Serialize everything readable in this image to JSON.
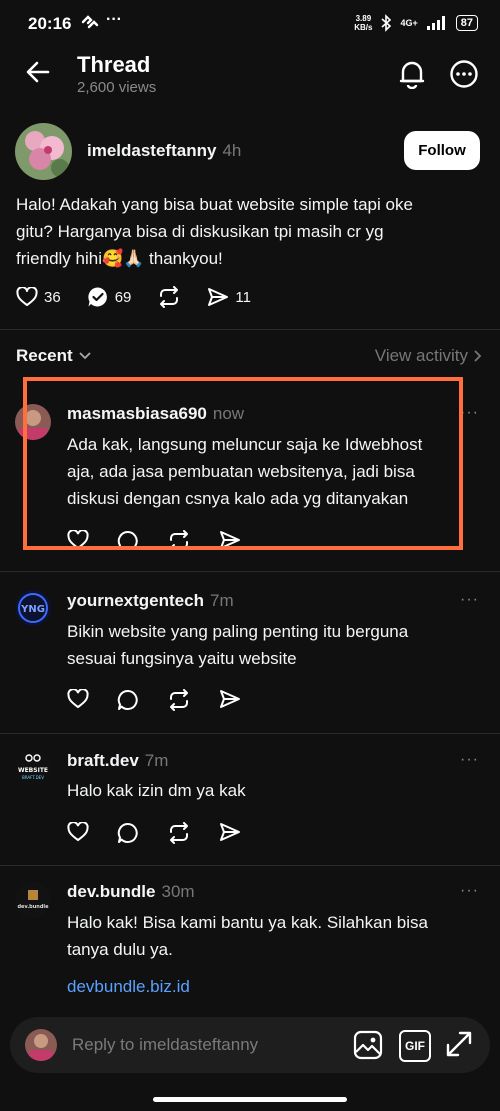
{
  "status_bar": {
    "time": "20:16",
    "speed_value": "3.89",
    "speed_unit": "KB/s",
    "network": "4G+",
    "battery": "87"
  },
  "header": {
    "title": "Thread",
    "views": "2,600 views"
  },
  "post": {
    "username": "imeldasteftanny",
    "time": "4h",
    "follow_label": "Follow",
    "text_line1": "Halo! Adakah yang bisa buat website simple tapi oke",
    "text_line2": "gitu? Harganya bisa di diskusikan tpi masih cr yg",
    "text_line3": "friendly hihi🥰🙏🏻 thankyou!",
    "likes": "36",
    "replies": "69",
    "shares": "11"
  },
  "recent": {
    "label": "Recent",
    "view_activity": "View activity"
  },
  "replies": [
    {
      "username": "masmasbiasa690",
      "time": "now",
      "line1": "Ada kak, langsung meluncur saja ke Idwebhost",
      "line2": "aja, ada jasa pembuatan websitenya, jadi bisa",
      "line3": "diskusi dengan csnya kalo ada yg ditanyakan"
    },
    {
      "username": "yournextgentech",
      "time": "7m",
      "line1": "Bikin website yang paling penting itu berguna",
      "line2": "sesuai fungsinya yaitu website"
    },
    {
      "username": "braft.dev",
      "time": "7m",
      "line1": "Halo kak izin dm ya kak"
    },
    {
      "username": "dev.bundle",
      "time": "30m",
      "line1": "Halo kak! Bisa kami bantu ya kak. Silahkan bisa",
      "line2": "tanya dulu ya.",
      "link": "devbundle.biz.id"
    }
  ],
  "reply_bar": {
    "placeholder": "Reply to imeldasteftanny",
    "gif_label": "GIF"
  },
  "colors": {
    "highlight": "#ff6f3c",
    "link": "#5aa1ff",
    "background": "#101010"
  }
}
